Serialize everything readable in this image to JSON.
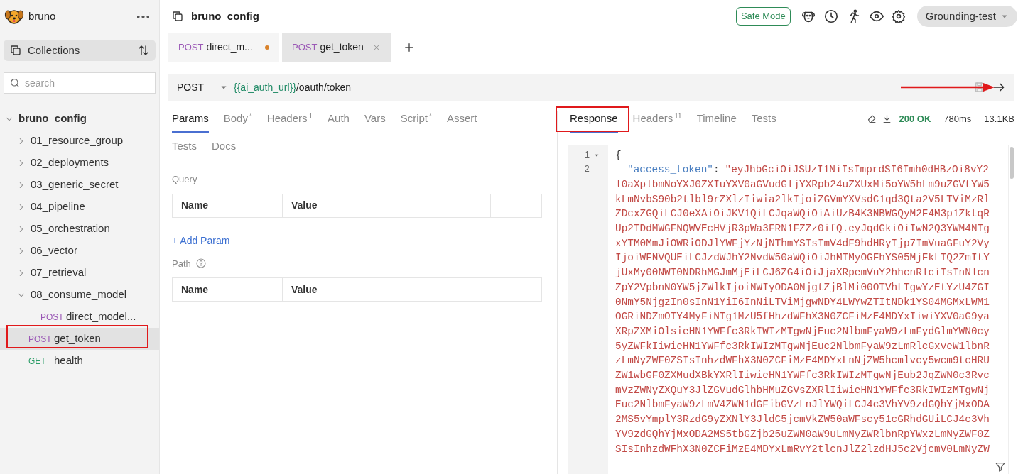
{
  "app": {
    "name": "bruno"
  },
  "sidebar": {
    "collections_label": "Collections",
    "search": {
      "placeholder": "search"
    },
    "tree": [
      {
        "kind": "collection",
        "label": "bruno_config",
        "expanded": true,
        "children": [
          {
            "kind": "folder",
            "label": "01_resource_group",
            "expanded": false
          },
          {
            "kind": "folder",
            "label": "02_deployments",
            "expanded": false
          },
          {
            "kind": "folder",
            "label": "03_generic_secret",
            "expanded": false
          },
          {
            "kind": "folder",
            "label": "04_pipeline",
            "expanded": false
          },
          {
            "kind": "folder",
            "label": "05_orchestration",
            "expanded": false
          },
          {
            "kind": "folder",
            "label": "06_vector",
            "expanded": false
          },
          {
            "kind": "folder",
            "label": "07_retrieval",
            "expanded": false
          },
          {
            "kind": "folder",
            "label": "08_consume_model",
            "expanded": true,
            "children": [
              {
                "kind": "request",
                "method": "POST",
                "label": "direct_model...",
                "selected": false
              }
            ]
          },
          {
            "kind": "request",
            "method": "POST",
            "label": "get_token",
            "selected": true
          },
          {
            "kind": "request",
            "method": "GET",
            "label": "health",
            "selected": false
          }
        ]
      }
    ]
  },
  "header": {
    "title": "bruno_config",
    "safe_mode": "Safe Mode",
    "environment": "Grounding-test"
  },
  "request_tabs": [
    {
      "method": "POST",
      "label": "direct_m...",
      "selected": false,
      "unsaved": true
    },
    {
      "method": "POST",
      "label": "get_token",
      "selected": true,
      "unsaved": false
    }
  ],
  "url_bar": {
    "method": "POST",
    "variable": "{{ai_auth_url}}",
    "path": "/oauth/token"
  },
  "request_panel": {
    "tabs": [
      {
        "label": "Params",
        "selected": true
      },
      {
        "label": "Body",
        "mark": "*",
        "selected": false
      },
      {
        "label": "Headers",
        "mark": "1",
        "selected": false
      },
      {
        "label": "Auth",
        "selected": false
      },
      {
        "label": "Vars",
        "selected": false
      },
      {
        "label": "Script",
        "mark": "*",
        "selected": false
      },
      {
        "label": "Assert",
        "selected": false
      },
      {
        "label": "Tests",
        "selected": false
      },
      {
        "label": "Docs",
        "selected": false
      }
    ],
    "query": {
      "label": "Query",
      "columns": [
        "Name",
        "Value"
      ]
    },
    "add_param": "+ Add Param",
    "path": {
      "label": "Path",
      "columns": [
        "Name",
        "Value"
      ]
    }
  },
  "response_panel": {
    "tabs": [
      {
        "label": "Response",
        "selected": true
      },
      {
        "label": "Headers",
        "mark": "11",
        "selected": false
      },
      {
        "label": "Timeline",
        "selected": false
      },
      {
        "label": "Tests",
        "selected": false
      }
    ],
    "status": "200 OK",
    "time": "780ms",
    "size": "13.1KB",
    "body": {
      "line_numbers": [
        "1",
        "2"
      ],
      "open": "{",
      "key": "\"access_token\"",
      "colon": ":",
      "value_lines": [
        "\"eyJhbGciOiJSUzI1NiIsImprdSI6Imh0dHBzOi8vY2",
        "l0aXplbmNoYXJ0ZXIuYXV0aGVudGljYXRpb24uZXUxMi5oYW5hLm9uZGVtYW5",
        "kLmNvbS90b2tlbl9rZXlzIiwia2lkIjoiZGVmYXVsdC1qd3Qta2V5LTViMzRl",
        "ZDcxZGQiLCJ0eXAiOiJKV1QiLCJqaWQiOiAiUzB4K3NBWGQyM2F4M3p1ZktqR",
        "Up2TDdMWGFNQWVEcHVjR3pWa3FRN1FZZz0ifQ.eyJqdGkiOiIwN2Q3YWM4NTg",
        "xYTM0MmJiOWRiODJlYWFjYzNjNThmYSIsImV4dF9hdHRyIjp7ImVuaGFuY2Vy",
        "IjoiWFNVQUEiLCJzdWJhY2NvdW50aWQiOiJhMTMyOGFhYS05MjFkLTQ2ZmItY",
        "jUxMy00NWI0NDRhMGJmMjEiLCJ6ZG4iOiJjaXRpemVuY2hhcnRlciIsInNlcn",
        "ZpY2VpbnN0YW5jZWlkIjoiNWIyODA0NjgtZjBlMi00OTVhLTgwYzEtYzU4ZGI",
        "0NmY5NjgzIn0sInN1YiI6InNiLTViMjgwNDY4LWYwZTItNDk1YS04MGMxLWM1",
        "OGRiNDZmOTY4MyFiNTg1MzU5fHhzdWFhX3N0ZCFiMzE4MDYxIiwiYXV0aG9ya",
        "XRpZXMiOlsieHN1YWFfc3RkIWIzMTgwNjEuc2NlbmFyaW9zLmFydGlmYWN0cy",
        "5yZWFkIiwieHN1YWFfc3RkIWIzMTgwNjEuc2NlbmFyaW9zLmRlcGxveW1lbnR",
        "zLmNyZWF0ZSIsInhzdWFhX3N0ZCFiMzE4MDYxLnNjZW5hcmlvcy5wcm9tcHRU",
        "ZW1wbGF0ZXMudXBkYXRlIiwieHN1YWFfc3RkIWIzMTgwNjEub2JqZWN0c3Rvc",
        "mVzZWNyZXQuY3JlZGVudGlhbHMuZGVsZXRlIiwieHN1YWFfc3RkIWIzMTgwNj",
        "Euc2NlbmFyaW9zLmV4ZWN1dGFibGVzLnJlYWQiLCJ4c3VhYV9zdGQhYjMxODA",
        "2MS5vYmplY3RzdG9yZXNlY3JldC5jcmVkZW50aWFscy51cGRhdGUiLCJ4c3Vh",
        "YV9zdGQhYjMxODA2MS5tbGZjb25uZWN0aW9uLmNyZWRlbnRpYWxzLmNyZWF0Z",
        "SIsInhzdWFhX3N0ZCFiMzE4MDYxLmRvY2tlcnJlZ2lzdHJ5c2VjcmV0LmNyZW"
      ]
    }
  }
}
